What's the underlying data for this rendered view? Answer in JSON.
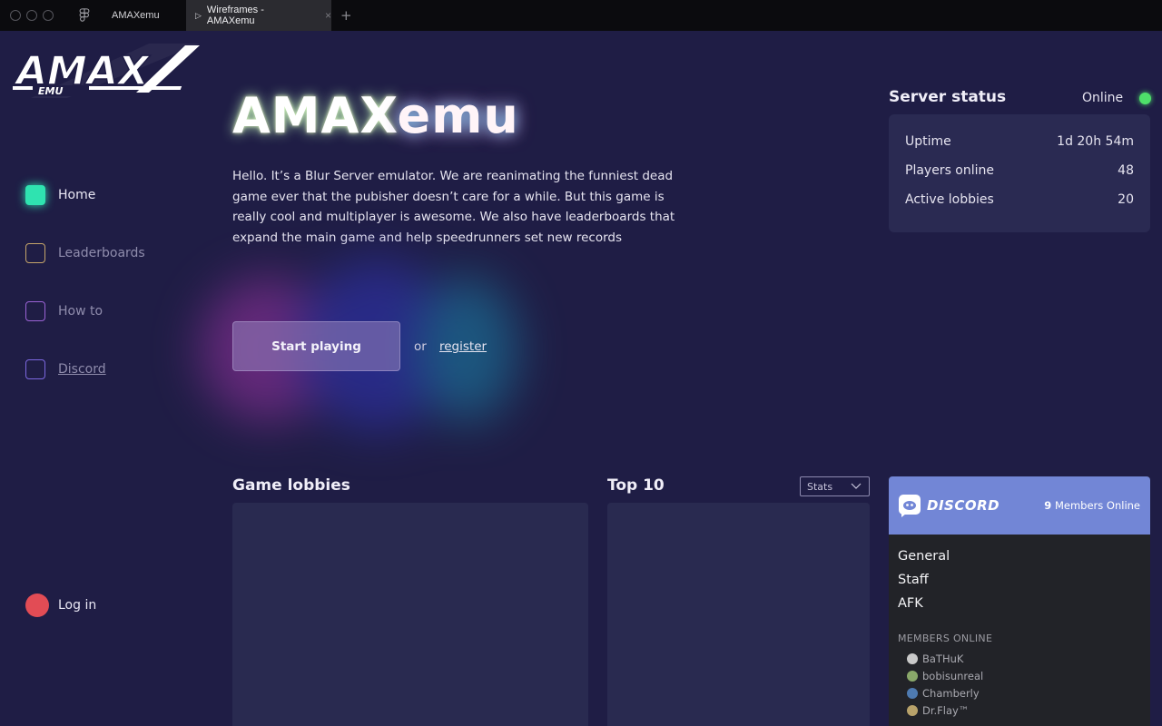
{
  "browser": {
    "tab_inactive": "AMAXemu",
    "tab_active": "Wireframes - AMAXemu",
    "tab_play_glyph": "▷",
    "tab_close_glyph": "×",
    "tab_add_glyph": "+"
  },
  "logo": {
    "main": "AMAX",
    "sub": "EMU"
  },
  "sidebar": {
    "items": [
      {
        "label": "Home",
        "icon": "square-filled-icon",
        "color": "#2fe3b0"
      },
      {
        "label": "Leaderboards",
        "icon": "square-outline-icon",
        "color": "#c5a56a"
      },
      {
        "label": "How to",
        "icon": "square-outline-icon",
        "color": "#9b63d6"
      },
      {
        "label": "Discord",
        "icon": "square-outline-icon",
        "color": "#7c68e0"
      }
    ],
    "login_label": "Log in",
    "login_color": "#e24c55"
  },
  "hero": {
    "title_part1": "AMAX",
    "title_part2": "emu",
    "description": "Hello. It’s a Blur Server emulator. We are reanimating the funniest dead game ever that the pubisher doesn’t care for a while. But this game is really cool and multiplayer is awesome. We also have leaderboards that expand the main game and help speedrunners set new records",
    "start_button": "Start playing",
    "or_text": "or",
    "register_link": "register"
  },
  "server_status": {
    "title": "Server status",
    "state": "Online",
    "state_color": "#4ee06a",
    "rows": [
      {
        "label": "Uptime",
        "value": "1d 20h 54m"
      },
      {
        "label": "Players online",
        "value": "48"
      },
      {
        "label": "Active lobbies",
        "value": "20"
      }
    ]
  },
  "lobbies": {
    "title": "Game lobbies"
  },
  "top10": {
    "title": "Top 10",
    "select_value": "Stats"
  },
  "discord": {
    "wordmark": "DISCORD",
    "members_count": "9",
    "members_label": "Members Online",
    "channels": [
      "General",
      "Staff",
      "AFK"
    ],
    "members_heading": "MEMBERS ONLINE",
    "members": [
      {
        "name": "BaTHuK",
        "avatar_color": "#c9c9c9"
      },
      {
        "name": "bobisunreal",
        "avatar_color": "#8aa86a"
      },
      {
        "name": "Chamberly",
        "avatar_color": "#4e7ab0"
      },
      {
        "name": "Dr.Flay™",
        "avatar_color": "#b8a26a"
      }
    ],
    "brand_color": "#7286d6"
  }
}
